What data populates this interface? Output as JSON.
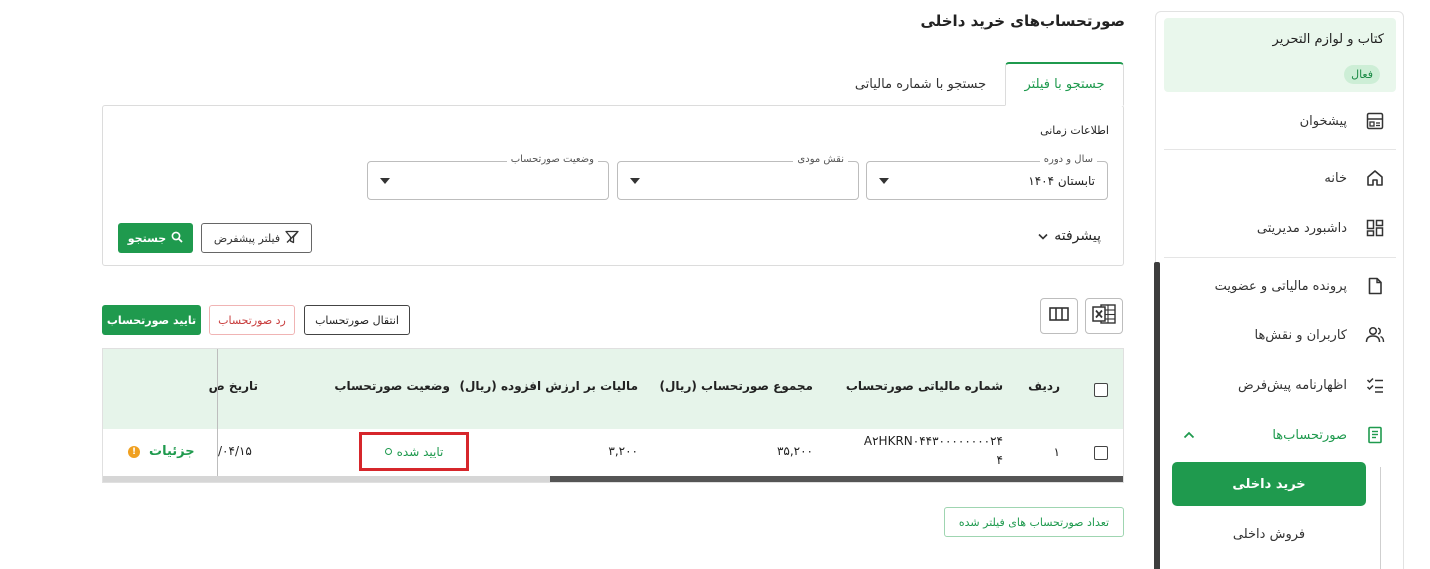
{
  "sidebar": {
    "business": {
      "name": "کتاب و لوازم التحریر",
      "status": "فعال"
    },
    "items": [
      {
        "label": "پیشخوان",
        "icon": "counter-icon"
      },
      {
        "label": "خانه",
        "icon": "home-icon"
      },
      {
        "label": "داشبورد مدیریتی",
        "icon": "dashboard-icon"
      },
      {
        "label": "پرونده مالیاتی و عضویت",
        "icon": "file-icon"
      },
      {
        "label": "کاربران و نقش‌ها",
        "icon": "users-icon"
      },
      {
        "label": "اظهارنامه پیش‌فرض",
        "icon": "checklist-icon"
      },
      {
        "label": "صورتحساب‌ها",
        "icon": "invoice-icon"
      }
    ],
    "submenu": {
      "active": "خرید داخلی",
      "other": "فروش داخلی"
    }
  },
  "main": {
    "title": "صورتحساب‌های خرید داخلی",
    "tabs": {
      "active": "جستجو با فیلتر",
      "inactive": "جستجو با شماره مالیاتی"
    },
    "filter": {
      "section_label": "اطلاعات زمانی",
      "year_period": {
        "label": "سال و دوره",
        "value": "تابستان ۱۴۰۴"
      },
      "role": {
        "label": "نقش مودی",
        "value": ""
      },
      "invoice_status": {
        "label": "وضعیت صورتحساب",
        "value": ""
      },
      "advanced_label": "پیشرفته",
      "default_filter_label": "فیلتر پیشفرض",
      "search_label": "جستجو"
    },
    "actions": {
      "confirm": "تایید صورتحساب",
      "reject": "رد صورتحساب",
      "transfer": "انتقال صورتحساب"
    },
    "table": {
      "columns": {
        "row": "ردیف",
        "tax_number": "شماره مالیاتی صورتحساب",
        "total": "مجموع صورتحساب (ریال)",
        "vat": "مالیات بر ارزش افزوده (ریال)",
        "status": "وضعیت صورتحساب",
        "date": "تاریخ ص"
      },
      "rows": [
        {
          "row": "۱",
          "tax_number_line1": "A۲HKRN۰۴۴۳۰۰۰۰۰۰۰۰۲۴",
          "tax_number_line2": "۴",
          "total": "۳۵,۲۰۰",
          "vat": "۳,۲۰۰",
          "status": "تایید شده",
          "date": "۰۴/۱۵/",
          "details": "جزئیات"
        }
      ]
    },
    "count_button": "تعداد صورتحساب های فیلتر شده"
  },
  "colors": {
    "accent": "#1f9a4e",
    "header_bg": "#e6f4ea",
    "highlight": "#d6262b"
  }
}
